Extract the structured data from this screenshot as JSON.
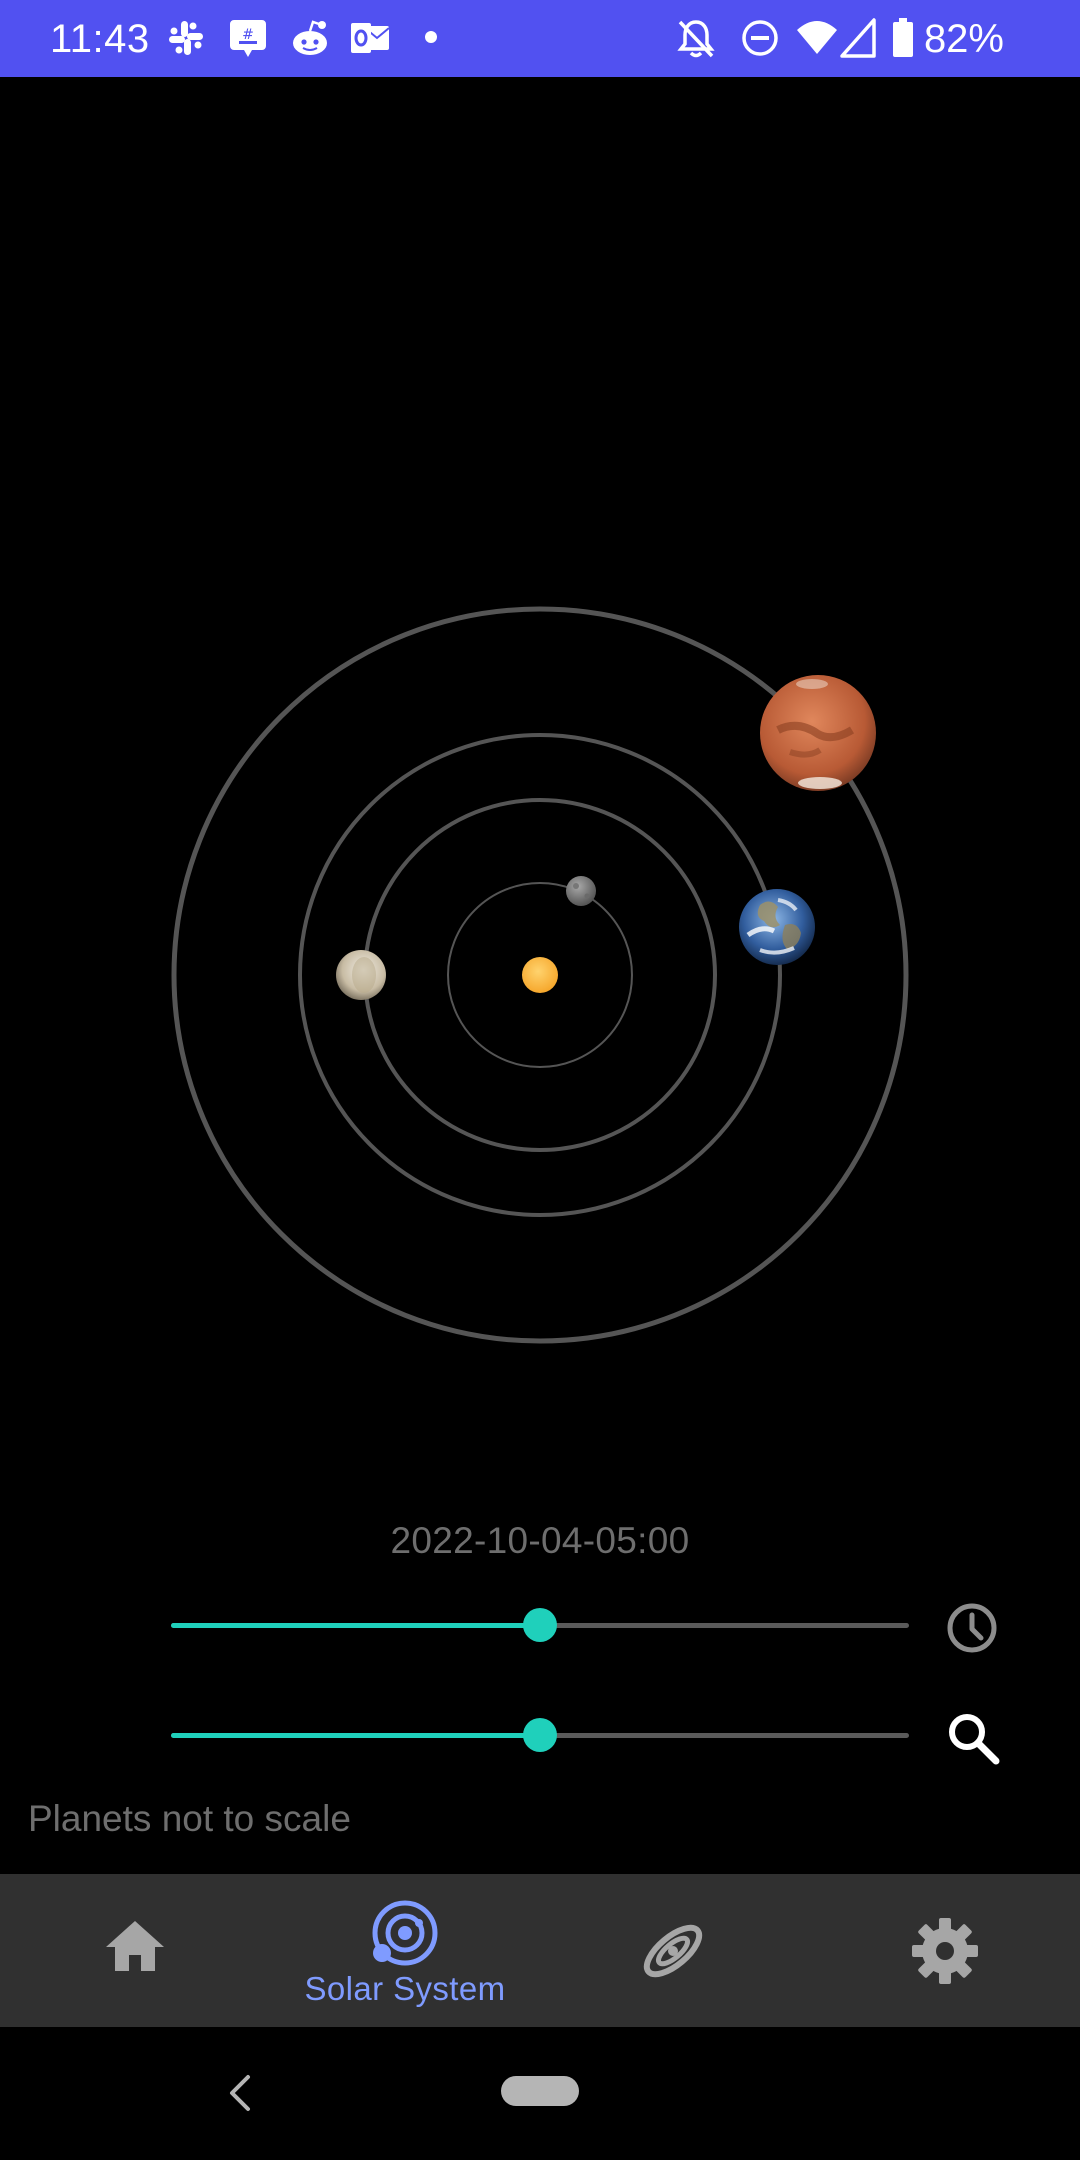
{
  "status_bar": {
    "time": "11:43",
    "battery": "82%",
    "background_color": "#5151f1",
    "notification_icons": [
      "slack-icon",
      "messaging-icon",
      "reddit-icon",
      "outlook-icon",
      "more-dot-icon"
    ],
    "system_icons": [
      "bell-off-icon",
      "do-not-disturb-icon",
      "wifi-icon",
      "cellular-signal-icon",
      "battery-icon"
    ]
  },
  "orbit_view": {
    "orbit_color": "#555555",
    "bodies": [
      "sun",
      "mercury",
      "venus",
      "earth",
      "mars"
    ],
    "sun_color": "#f6a72c"
  },
  "controls": {
    "date": "2022-10-04-05:00",
    "time_slider_value": 0.5,
    "zoom_slider_value": 0.5,
    "accent_color": "#1fd0bb",
    "time_icon": "clock-icon",
    "zoom_icon": "search-icon"
  },
  "footer_note": "Planets not to scale",
  "bottom_nav": {
    "items": [
      {
        "label": "",
        "icon": "home-icon",
        "selected": false
      },
      {
        "label": "Solar System",
        "icon": "solar-system-icon",
        "selected": true
      },
      {
        "label": "",
        "icon": "galaxy-icon",
        "selected": false
      },
      {
        "label": "",
        "icon": "gear-icon",
        "selected": false
      }
    ],
    "selected_color": "#7f9bff"
  }
}
